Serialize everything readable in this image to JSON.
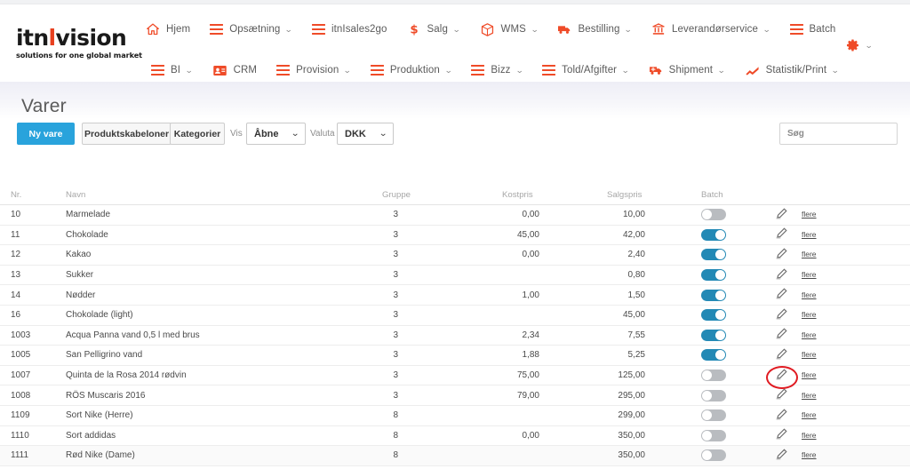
{
  "brand": {
    "logo_part1": "itn",
    "logo_bar": "l",
    "logo_part2": "vision",
    "tagline": "solutions for one global market",
    "accent_color": "#ef4b28",
    "primary_color": "#29a3dc",
    "toggle_on_color": "#2389b5",
    "toggle_off_color": "#b9bcc0",
    "annotation_color": "#e01b22"
  },
  "nav": {
    "row1": [
      {
        "label": "Hjem",
        "icon": "home-icon",
        "caret": false
      },
      {
        "label": "Opsætning",
        "icon": "hamburger-icon",
        "caret": true
      },
      {
        "label": "itnIsales2go",
        "icon": "hamburger-icon",
        "caret": false
      },
      {
        "label": "Salg",
        "icon": "dollar-icon",
        "caret": true
      },
      {
        "label": "WMS",
        "icon": "box-icon",
        "caret": true
      },
      {
        "label": "Bestilling",
        "icon": "truck-icon",
        "caret": true
      },
      {
        "label": "Leverandørservice",
        "icon": "bank-icon",
        "caret": true
      },
      {
        "label": "Batch",
        "icon": "hamburger-icon",
        "caret": false
      }
    ],
    "row2": [
      {
        "label": "BI",
        "icon": "hamburger-icon",
        "caret": true
      },
      {
        "label": "CRM",
        "icon": "contact-card-icon",
        "caret": false
      },
      {
        "label": "Provision",
        "icon": "hamburger-icon",
        "caret": true
      },
      {
        "label": "Produktion",
        "icon": "hamburger-icon",
        "caret": true
      },
      {
        "label": "Bizz",
        "icon": "hamburger-icon",
        "caret": true
      },
      {
        "label": "Told/Afgifter",
        "icon": "hamburger-icon",
        "caret": true
      },
      {
        "label": "Shipment",
        "icon": "shipment-truck-icon",
        "caret": true
      },
      {
        "label": "Statistik/Print",
        "icon": "chart-line-icon",
        "caret": true
      }
    ],
    "settings_icon": "gear-icon",
    "settings_caret": "⌄"
  },
  "page": {
    "title": "Varer"
  },
  "toolbar": {
    "new_item_label": "Ny vare",
    "templates_label": "Produktskabeloner",
    "categories_label": "Kategorier",
    "vis_label": "Vis",
    "vis_value": "Åbne",
    "valuta_label": "Valuta",
    "valuta_value": "DKK",
    "search_placeholder": "Søg",
    "search_value": "",
    "search_icon": "search-icon"
  },
  "table": {
    "columns": [
      "Nr.",
      "Navn",
      "Gruppe",
      "Kostpris",
      "Salgspris",
      "Batch"
    ],
    "more_link_label": "flere",
    "edit_icon": "pencil-edit-icon",
    "rows": [
      {
        "nr": "10",
        "navn": "Marmelade",
        "gruppe": "3",
        "kostpris": "0,00",
        "salgspris": "10,00",
        "batch": false
      },
      {
        "nr": "11",
        "navn": "Chokolade",
        "gruppe": "3",
        "kostpris": "45,00",
        "salgspris": "42,00",
        "batch": true
      },
      {
        "nr": "12",
        "navn": "Kakao",
        "gruppe": "3",
        "kostpris": "0,00",
        "salgspris": "2,40",
        "batch": true
      },
      {
        "nr": "13",
        "navn": "Sukker",
        "gruppe": "3",
        "kostpris": "",
        "salgspris": "0,80",
        "batch": true
      },
      {
        "nr": "14",
        "navn": "Nødder",
        "gruppe": "3",
        "kostpris": "1,00",
        "salgspris": "1,50",
        "batch": true
      },
      {
        "nr": "16",
        "navn": "Chokolade (light)",
        "gruppe": "3",
        "kostpris": "",
        "salgspris": "45,00",
        "batch": true
      },
      {
        "nr": "1003",
        "navn": "Acqua Panna vand 0,5 l med brus",
        "gruppe": "3",
        "kostpris": "2,34",
        "salgspris": "7,55",
        "batch": true
      },
      {
        "nr": "1005",
        "navn": "San Pelligrino vand",
        "gruppe": "3",
        "kostpris": "1,88",
        "salgspris": "5,25",
        "batch": true
      },
      {
        "nr": "1007",
        "navn": "Quinta de la Rosa 2014 rødvin",
        "gruppe": "3",
        "kostpris": "75,00",
        "salgspris": "125,00",
        "batch": false
      },
      {
        "nr": "1008",
        "navn": "RÖS Muscaris 2016",
        "gruppe": "3",
        "kostpris": "79,00",
        "salgspris": "295,00",
        "batch": false
      },
      {
        "nr": "1109",
        "navn": "Sort Nike (Herre)",
        "gruppe": "8",
        "kostpris": "",
        "salgspris": "299,00",
        "batch": false
      },
      {
        "nr": "1110",
        "navn": "Sort addidas",
        "gruppe": "8",
        "kostpris": "0,00",
        "salgspris": "350,00",
        "batch": false
      },
      {
        "nr": "1111",
        "navn": "Rød Nike (Dame)",
        "gruppe": "8",
        "kostpris": "",
        "salgspris": "350,00",
        "batch": false
      }
    ],
    "annotated_row_nr": "1007"
  }
}
